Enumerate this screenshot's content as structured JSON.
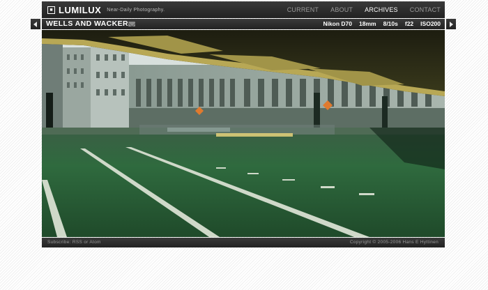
{
  "site": {
    "logo_text": "LUMILUX",
    "logo_icon": "square-logo-icon",
    "tagline": "Near-Daily Photography."
  },
  "nav": {
    "items": [
      {
        "label": "CURRENT",
        "active": false
      },
      {
        "label": "ABOUT",
        "active": false
      },
      {
        "label": "ARCHIVES",
        "active": true
      },
      {
        "label": "CONTACT",
        "active": false
      }
    ]
  },
  "photo": {
    "title": "WELLS AND WACKER",
    "comment_icon": "mail-icon",
    "exif": {
      "camera": "Nikon D70",
      "focal_length": "18mm",
      "shutter": "8/10s",
      "aperture": "f22",
      "iso": "ISO200"
    },
    "prev_icon": "arrow-left-icon",
    "next_icon": "arrow-right-icon"
  },
  "footer": {
    "subscribe_prefix": "Subscribe:",
    "rss_label": "RSS",
    "or_label": "or",
    "atom_label": "Atom",
    "copyright": "Copyright © 2005-2006  Hans E Hyttinen"
  },
  "colors": {
    "bar_background": "#2b2b2b",
    "nav_inactive": "#9a9a9a",
    "nav_active": "#ffffff",
    "photo_green": "#2f6b3c"
  }
}
